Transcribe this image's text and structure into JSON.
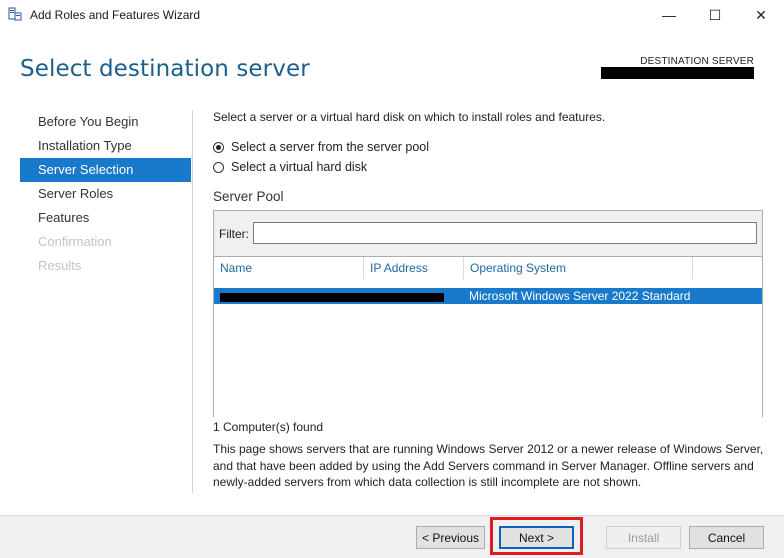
{
  "window": {
    "title": "Add Roles and Features Wizard",
    "controls": {
      "minimize": "—",
      "maximize": "☐",
      "close": "✕"
    },
    "icon": "server-manager-icon"
  },
  "header": {
    "page_title": "Select destination server",
    "destination_label": "DESTINATION SERVER"
  },
  "nav": {
    "items": [
      {
        "label": "Before You Begin",
        "state": "normal"
      },
      {
        "label": "Installation Type",
        "state": "normal"
      },
      {
        "label": "Server Selection",
        "state": "active"
      },
      {
        "label": "Server Roles",
        "state": "normal"
      },
      {
        "label": "Features",
        "state": "normal"
      },
      {
        "label": "Confirmation",
        "state": "disabled"
      },
      {
        "label": "Results",
        "state": "disabled"
      }
    ]
  },
  "main": {
    "intro": "Select a server or a virtual hard disk on which to install roles and features.",
    "options": [
      {
        "label": "Select a server from the server pool",
        "checked": true
      },
      {
        "label": "Select a virtual hard disk",
        "checked": false
      }
    ],
    "server_pool": {
      "title": "Server Pool",
      "filter_label": "Filter:",
      "filter_value": "",
      "columns": [
        "Name",
        "IP Address",
        "Operating System"
      ],
      "rows": [
        {
          "name": "",
          "ip": "",
          "os": "Microsoft Windows Server 2022 Standard",
          "selected": true
        }
      ]
    },
    "found": "1 Computer(s) found",
    "description": "This page shows servers that are running Windows Server 2012 or a newer release of Windows Server, and that have been added by using the Add Servers command in Server Manager. Offline servers and newly-added servers from which data collection is still incomplete are not shown."
  },
  "footer": {
    "previous": "< Previous",
    "next": "Next >",
    "install": "Install",
    "cancel": "Cancel"
  },
  "colors": {
    "accent": "#1979ca",
    "title": "#1b5f8c",
    "highlight": "#e01b24"
  }
}
